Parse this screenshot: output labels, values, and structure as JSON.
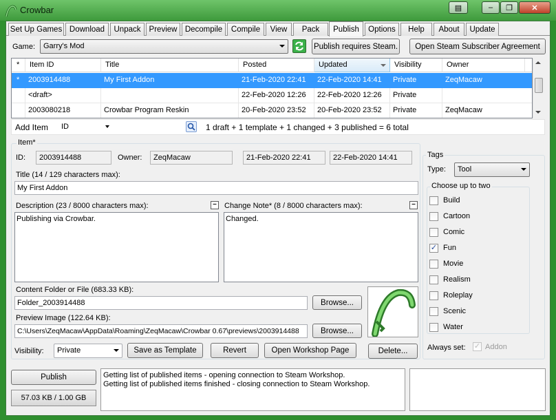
{
  "window": {
    "title": "Crowbar",
    "controls": {
      "minimize": "–",
      "restore": "❐",
      "close": "✕"
    }
  },
  "tabs": [
    {
      "label": "Set Up Games"
    },
    {
      "label": "Download"
    },
    {
      "label": "Unpack"
    },
    {
      "label": "Preview"
    },
    {
      "label": "Decompile"
    },
    {
      "label": "Compile"
    },
    {
      "label": "View"
    },
    {
      "label": "Pack"
    },
    {
      "label": "Publish"
    },
    {
      "label": "Options"
    },
    {
      "label": "Help"
    },
    {
      "label": "About"
    },
    {
      "label": "Update"
    }
  ],
  "active_tab": "Publish",
  "game_row": {
    "label": "Game:",
    "selected": "Garry's Mod",
    "refresh_icon": "refresh-icon",
    "publish_requires_label": "Publish requires Steam.",
    "agreement_label": "Open Steam Subscriber Agreement"
  },
  "table": {
    "headers": [
      "*",
      "Item ID",
      "Title",
      "Posted",
      "Updated",
      "Visibility",
      "Owner"
    ],
    "sorted_column": "Updated",
    "rows": [
      [
        "*",
        "2003914488",
        "My First Addon",
        "21-Feb-2020 22:41",
        "22-Feb-2020 14:41",
        "Private",
        "ZeqMacaw"
      ],
      [
        "",
        "<draft>",
        "",
        "22-Feb-2020 12:26",
        "22-Feb-2020 12:26",
        "Private",
        ""
      ],
      [
        "",
        "2003080218",
        "Crowbar Program Reskin",
        "20-Feb-2020 23:52",
        "20-Feb-2020 23:52",
        "Private",
        "ZeqMacaw"
      ]
    ],
    "selected_row": 0
  },
  "add_item": {
    "label": "Add Item",
    "search_by": "ID",
    "search_value": "",
    "summary": "1 draft + 1 template + 1 changed + 3 published = 6 total"
  },
  "item": {
    "group_label": "Item*",
    "id_label": "ID:",
    "id_value": "2003914488",
    "owner_label": "Owner:",
    "owner_value": "ZeqMacaw",
    "posted_value": "21-Feb-2020 22:41",
    "updated_value": "22-Feb-2020 14:41",
    "title_label": "Title (14 / 129 characters max):",
    "title_value": "My First Addon",
    "description_label": "Description (23 / 8000 characters max):",
    "description_value": "Publishing via Crowbar.",
    "change_note_label": "Change Note* (8 / 8000 characters max):",
    "change_note_value": "Changed.",
    "collapse_symbol": "–",
    "content_label": "Content Folder or File (683.33 KB):",
    "content_value": "Folder_2003914488",
    "preview_label": "Preview Image (122.64 KB):",
    "preview_value": "C:\\Users\\ZeqMacaw\\AppData\\Roaming\\ZeqMacaw\\Crowbar 0.67\\previews\\2003914488",
    "browse_label": "Browse...",
    "visibility_label": "Visibility:",
    "visibility_value": "Private",
    "save_template_label": "Save as Template",
    "revert_label": "Revert",
    "workshop_label": "Open Workshop Page",
    "delete_label": "Delete..."
  },
  "tags": {
    "group_label": "Tags",
    "type_label": "Type:",
    "type_value": "Tool",
    "choose_label": "Choose up to two",
    "options": [
      {
        "label": "Build",
        "checked": false
      },
      {
        "label": "Cartoon",
        "checked": false
      },
      {
        "label": "Comic",
        "checked": false
      },
      {
        "label": "Fun",
        "checked": true
      },
      {
        "label": "Movie",
        "checked": false
      },
      {
        "label": "Realism",
        "checked": false
      },
      {
        "label": "Roleplay",
        "checked": false
      },
      {
        "label": "Scenic",
        "checked": false
      },
      {
        "label": "Water",
        "checked": false
      }
    ],
    "always_set_label": "Always set:",
    "always_set_value": "Addon"
  },
  "bottom": {
    "publish_label": "Publish",
    "quota_label": "57.03 KB / 1.00 GB",
    "log_lines": [
      "Getting list of published items - opening connection to Steam Workshop.",
      "Getting list of published items finished - closing connection to Steam Workshop."
    ]
  },
  "colors": {
    "accent": "#3399ff",
    "title_bar": "#4aa648",
    "window_bg": "#f0f0f0"
  }
}
